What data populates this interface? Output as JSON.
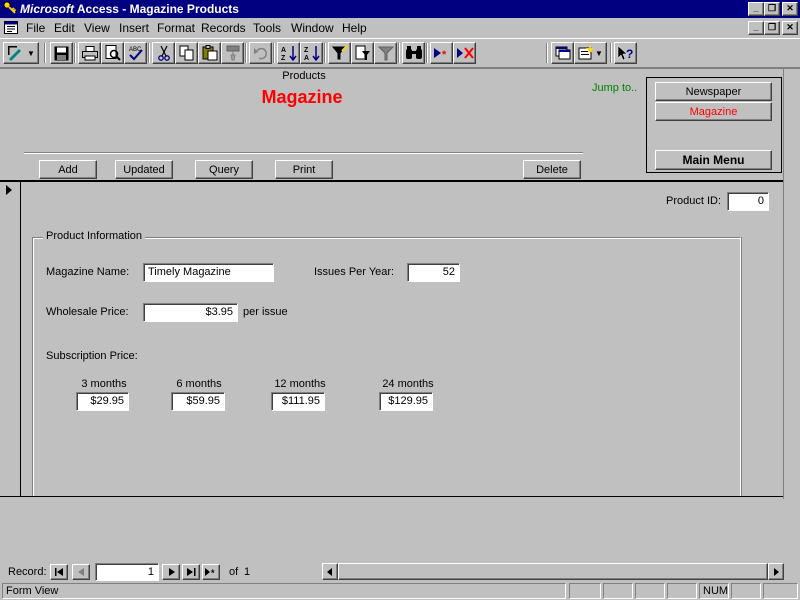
{
  "window": {
    "title_brand": "Microsoft",
    "title_rest": "Access - Magazine Products"
  },
  "menu": [
    "File",
    "Edit",
    "View",
    "Insert",
    "Format",
    "Records",
    "Tools",
    "Window",
    "Help"
  ],
  "toolbar_icons": [
    "form-view-icon",
    "save-icon",
    "print-icon",
    "print-preview-icon",
    "spelling-icon",
    "cut-icon",
    "copy-icon",
    "paste-icon",
    "format-painter-icon",
    "undo-icon",
    "sort-ascending-icon",
    "sort-descending-icon",
    "filter-by-selection-icon",
    "filter-by-form-icon",
    "apply-filter-icon",
    "find-icon",
    "new-record-icon",
    "delete-record-icon",
    "database-window-icon",
    "new-object-icon",
    "help-icon"
  ],
  "header": {
    "caption": "Products",
    "title": "Magazine",
    "jump_to": "Jump to..",
    "title_color": "#ff0000",
    "jump_color": "#008000"
  },
  "nav_buttons": {
    "newspaper": "Newspaper",
    "magazine": "Magazine",
    "main_menu": "Main Menu"
  },
  "actions": {
    "add": "Add",
    "updated": "Updated",
    "query": "Query",
    "print": "Print",
    "delete": "Delete"
  },
  "product_id": {
    "label": "Product ID:",
    "value": "0"
  },
  "product_info": {
    "group_label": "Product Information",
    "magazine_name_label": "Magazine Name:",
    "magazine_name": "Timely Magazine",
    "issues_label": "Issues Per Year:",
    "issues": "52",
    "wholesale_label": "Wholesale Price:",
    "wholesale": "$3.95",
    "per_issue": "per issue",
    "subscription_label": "Subscription Price:",
    "subscriptions": [
      {
        "label": "3 months",
        "value": "$29.95"
      },
      {
        "label": "6 months",
        "value": "$59.95"
      },
      {
        "label": "12 months",
        "value": "$111.95"
      },
      {
        "label": "24 months",
        "value": "$129.95"
      }
    ]
  },
  "record_nav": {
    "label": "Record:",
    "current": "1",
    "of": "of",
    "total": "1"
  },
  "status": {
    "mode": "Form View",
    "num": "NUM"
  }
}
